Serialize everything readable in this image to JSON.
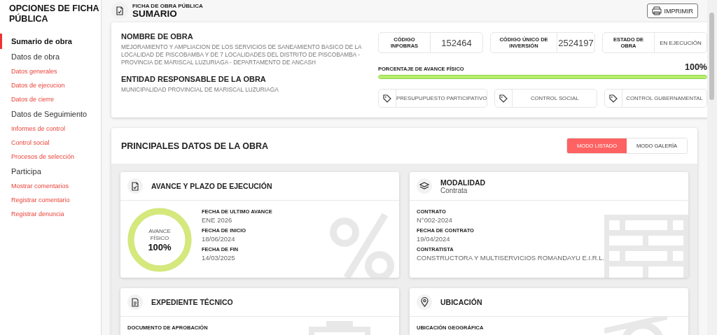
{
  "sidebar": {
    "title": "OPCIONES DE FICHA PÚBLICA",
    "items": [
      {
        "label": "Sumario de obra",
        "kind": "group",
        "selected": true
      },
      {
        "label": "Datos de obra",
        "kind": "group",
        "selected": false
      },
      {
        "label": "Datos generales",
        "kind": "link",
        "selected": false
      },
      {
        "label": "Datos de ejecucion",
        "kind": "link",
        "selected": false
      },
      {
        "label": "Datos de cierre",
        "kind": "link",
        "selected": false
      },
      {
        "label": "Datos de Seguimiento",
        "kind": "group",
        "selected": false
      },
      {
        "label": "Informes de control",
        "kind": "link",
        "selected": false
      },
      {
        "label": "Control social",
        "kind": "link",
        "selected": false
      },
      {
        "label": "Procesos de selección",
        "kind": "link",
        "selected": false
      },
      {
        "label": "Participa",
        "kind": "group",
        "selected": false
      },
      {
        "label": "Mostrar comentarios",
        "kind": "link",
        "selected": false
      },
      {
        "label": "Registrar comentario",
        "kind": "link",
        "selected": false
      },
      {
        "label": "Registrar denuncia",
        "kind": "link",
        "selected": false
      }
    ]
  },
  "header": {
    "overline": "FICHA DE OBRA PÚBLICA",
    "title": "SUMARIO",
    "print_button": "IMPRIMIR"
  },
  "summary": {
    "name_label": "NOMBRE DE OBRA",
    "name": "MEJORAMIENTO Y AMPLIACION DE LOS SERVICIOS DE SANEAMIENTO BASICO DE LA LOCALIDAD DE PISCOBAMBA Y DE 7 LOCALIDADES DEL DISTRITO DE PISCOBAMBA - PROVINCIA DE MARISCAL LUZURIAGA - DEPARTAMENTO DE ANCASH",
    "entity_label": "ENTIDAD RESPONSABLE DE LA OBRA",
    "entity": "MUNICIPALIDAD PROVINCIAL DE MARISCAL LUZURIAGA",
    "codes": [
      {
        "label": "CÓDIGO INFOBRAS",
        "value": "152464",
        "kind": "number"
      },
      {
        "label": "CÓDIGO ÚNICO DE INVERSIÓN",
        "value": "2524197",
        "kind": "number"
      },
      {
        "label": "ESTADO DE OBRA",
        "value": "EN EJECUCIÓN",
        "kind": "status"
      }
    ],
    "progress": {
      "label": "PORCENTAJE DE AVANCE FÍSICO",
      "reading": "100%",
      "level": 1
    },
    "tags": [
      "PRESUPUPUESTO PARTICIPATIVO",
      "CONTROL SOCIAL",
      "CONTROL GUBERNAMENTAL"
    ]
  },
  "main": {
    "title": "PRINCIPALES DATOS DE LA OBRA",
    "view_modes": [
      {
        "label": "MODO LISTADO",
        "selected": true
      },
      {
        "label": "MODO GALERÍA",
        "selected": false
      }
    ],
    "cards": [
      {
        "kind": "avance",
        "title": "AVANCE Y PLAZO DE EJECUCIÓN",
        "ring": {
          "label": "AVANCE FÍSICO",
          "reading": "100%",
          "level": 1
        },
        "fields": [
          {
            "label": "FECHA DE ULTIMO AVANCE",
            "value": "ENE 2026"
          },
          {
            "label": "FECHA DE INICIO",
            "value": "18/06/2024"
          },
          {
            "label": "FECHA DE FIN",
            "value": "14/03/2025"
          }
        ]
      },
      {
        "kind": "modalidad",
        "title": "MODALIDAD",
        "subtitle": "Contrata",
        "fields": [
          {
            "label": "CONTRATO",
            "value": "N°002-2024"
          },
          {
            "label": "FECHA DE CONTRATO",
            "value": "19/04/2024"
          },
          {
            "label": "CONTRATISTA",
            "value": "CONSTRUCTORA Y MULTISERVICIOS ROMANDAYU E.I.R.L."
          }
        ]
      },
      {
        "kind": "expediente",
        "title": "EXPEDIENTE TÉCNICO",
        "fields": [
          {
            "label": "DOCUMENTO DE APROBACIÓN"
          }
        ]
      },
      {
        "kind": "ubicacion",
        "title": "UBICACIÓN",
        "fields": [
          {
            "label": "UBICACIÓN GEOGRÁFICA"
          }
        ]
      }
    ]
  }
}
